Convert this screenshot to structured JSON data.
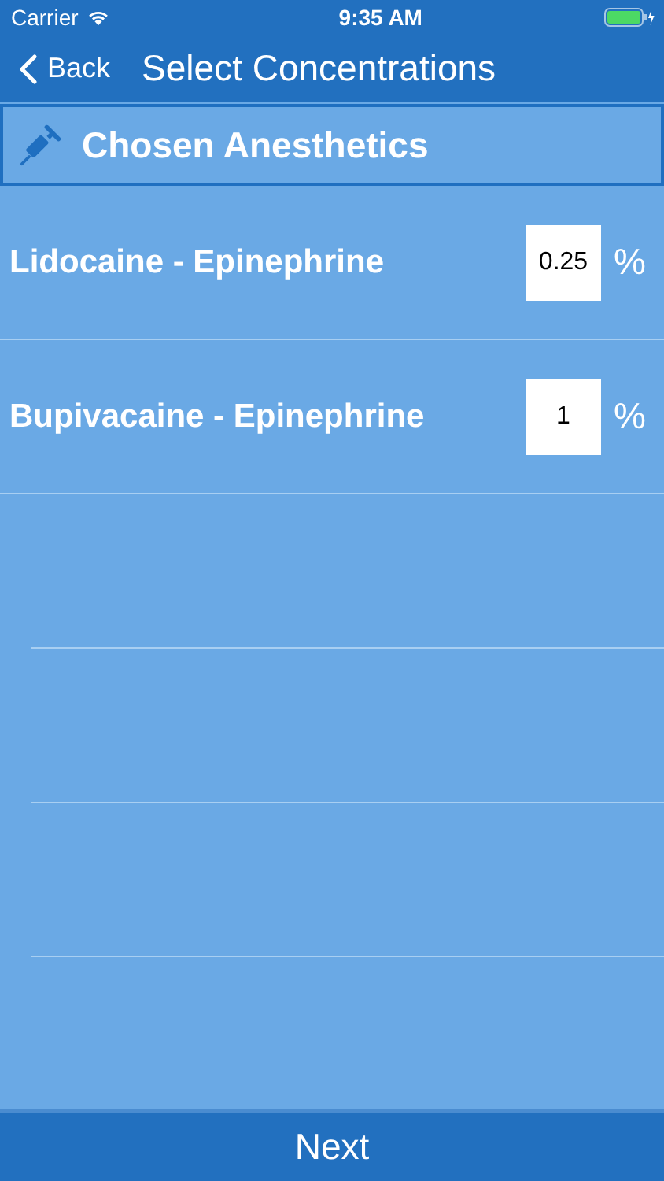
{
  "status_bar": {
    "carrier": "Carrier",
    "time": "9:35 AM"
  },
  "nav": {
    "back": "Back",
    "title": "Select Concentrations"
  },
  "section": {
    "title": "Chosen Anesthetics"
  },
  "rows": [
    {
      "name": "Lidocaine - Epinephrine",
      "value": "0.25",
      "unit": "%"
    },
    {
      "name": "Bupivacaine - Epinephrine",
      "value": "1",
      "unit": "%"
    }
  ],
  "footer": {
    "button": "Next"
  }
}
